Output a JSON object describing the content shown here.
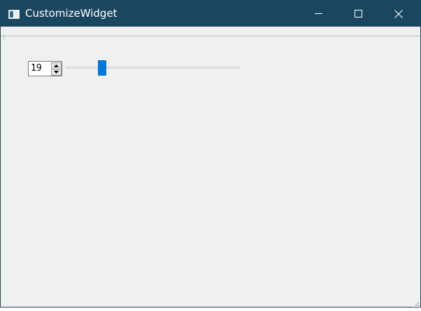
{
  "window": {
    "title": "CustomizeWidget",
    "icons": {
      "app": "window-icon",
      "minimize": "minimize-icon",
      "maximize": "maximize-icon",
      "close": "close-icon",
      "toolbar_grip": "grip-dots-icon",
      "size_grip": "resize-grip-icon",
      "spin_up": "arrow-up-icon",
      "spin_down": "arrow-down-icon"
    }
  },
  "controls": {
    "spinbox": {
      "value": "19"
    },
    "slider": {
      "value": 19,
      "min": 0,
      "max": 99
    }
  },
  "colors": {
    "titlebar": "#1b4660",
    "accent": "#0078d7",
    "window_bg": "#f0f0f0"
  }
}
